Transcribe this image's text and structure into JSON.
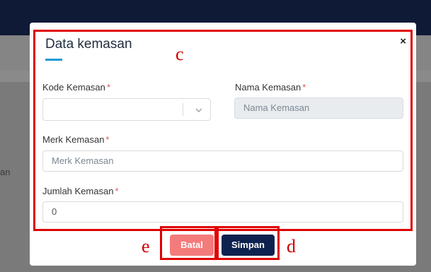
{
  "background": {
    "side_text": "an"
  },
  "modal": {
    "title": "Data kemasan",
    "close_label": "×",
    "fields": {
      "kode_kemasan": {
        "label": "Kode Kemasan",
        "value": ""
      },
      "nama_kemasan": {
        "label": "Nama Kemasan",
        "placeholder": "Nama Kemasan"
      },
      "merk_kemasan": {
        "label": "Merk Kemasan",
        "placeholder": "Merk Kemasan"
      },
      "jumlah_kemasan": {
        "label": "Jumlah Kemasan",
        "value": "0"
      }
    },
    "required_marker": "*",
    "buttons": {
      "cancel": "Batal",
      "save": "Simpan"
    }
  },
  "annotations": {
    "form_box": "c",
    "save_box": "d",
    "cancel_box": "e"
  },
  "colors": {
    "cancel_button": "#f47b7b",
    "save_button": "#0e2250",
    "required_asterisk": "#e0555b",
    "title_accent": "#1e9ad6",
    "annotation": "#e00000"
  },
  "icons": {
    "close": "close-icon",
    "dropdown": "chevron-down-icon"
  }
}
